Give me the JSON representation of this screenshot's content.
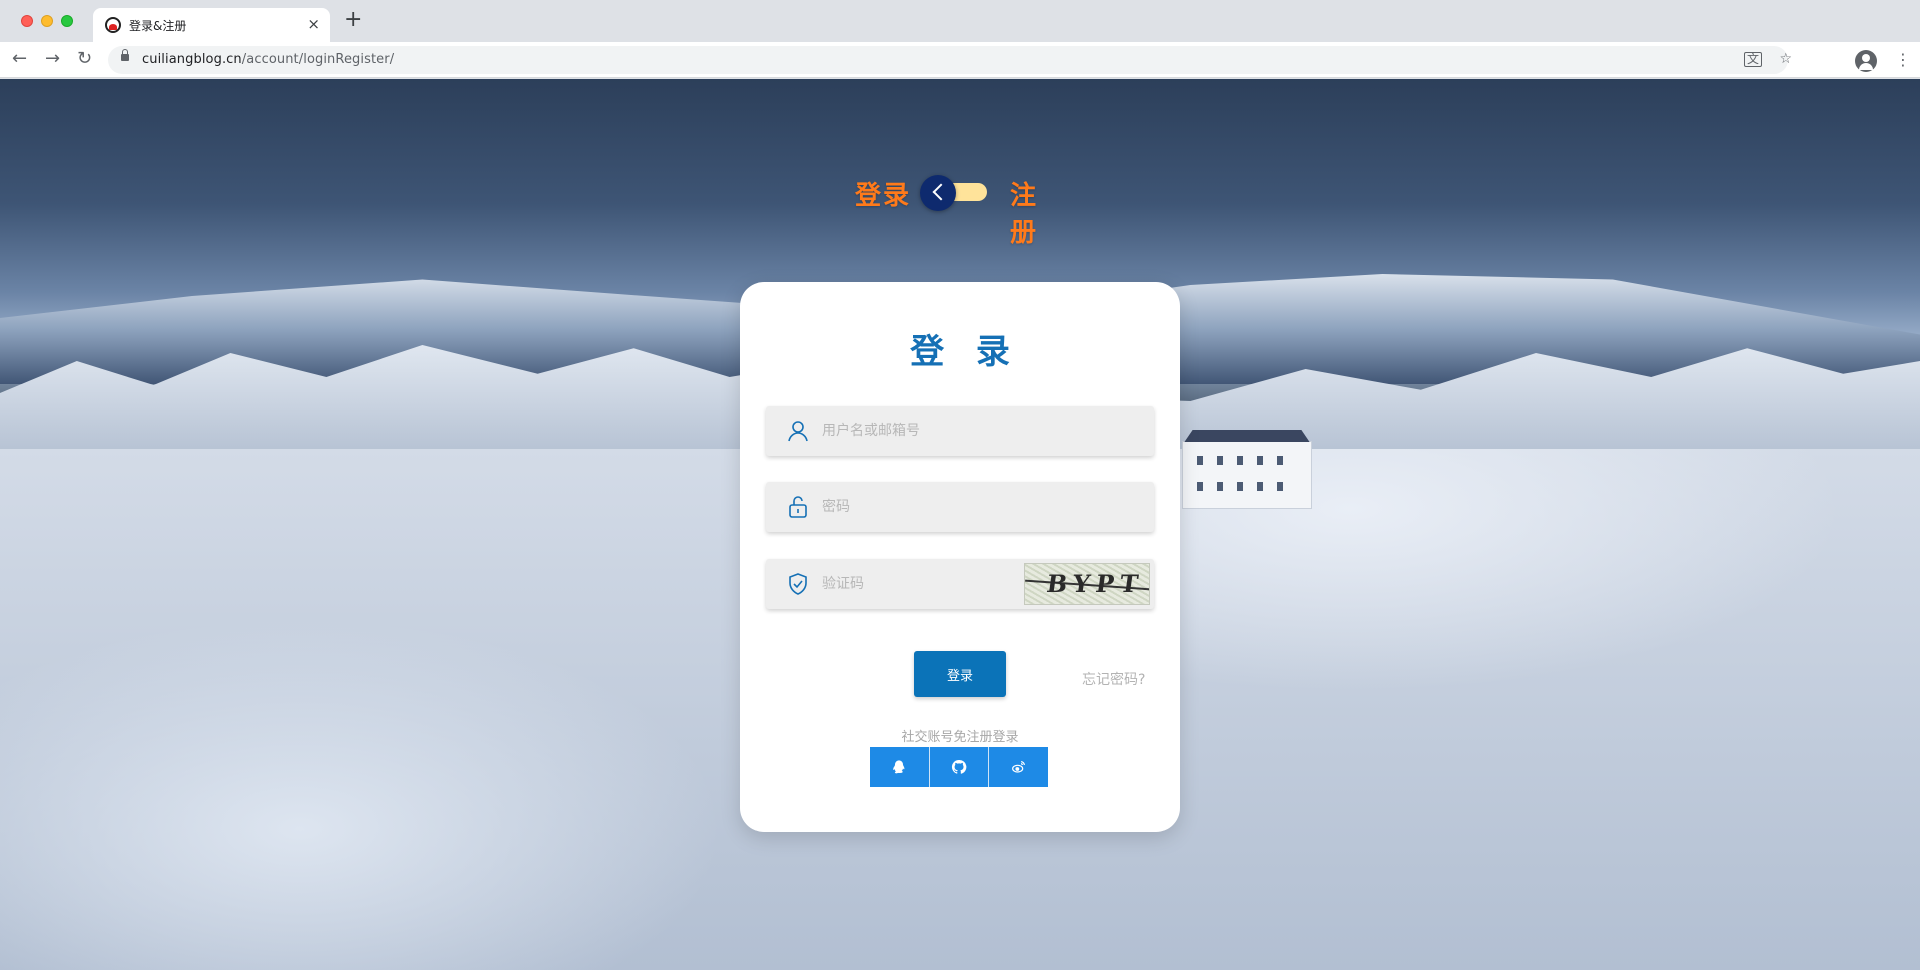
{
  "browser": {
    "tab_title": "登录&注册",
    "tab_close": "×",
    "new_tab": "+",
    "url_host": "cuiliangblog.cn",
    "url_path": "/account/loginRegister/",
    "icons": [
      "back-icon",
      "forward-icon",
      "reload-icon",
      "lock-icon",
      "translate-icon",
      "star-icon",
      "profile-icon",
      "menu-icon"
    ]
  },
  "switch": {
    "login_label": "登录",
    "register_label": "注册",
    "state": "login"
  },
  "form": {
    "title": "登 录",
    "username_placeholder": "用户名或邮箱号",
    "password_placeholder": "密码",
    "captcha_placeholder": "验证码",
    "captcha_text": "BYPT",
    "login_button": "登录",
    "forgot_link": "忘记密码?",
    "social_label": "社交账号免注册登录",
    "social_providers": [
      "qq-icon",
      "github-icon",
      "weibo-icon"
    ]
  },
  "colors": {
    "primary": "#0b73b8",
    "title": "#1570b5",
    "switch_label": "#ff7a1a",
    "switch_knob": "#0e2a6e",
    "switch_track": "#ffe39a",
    "social": "#1e8ae6"
  }
}
